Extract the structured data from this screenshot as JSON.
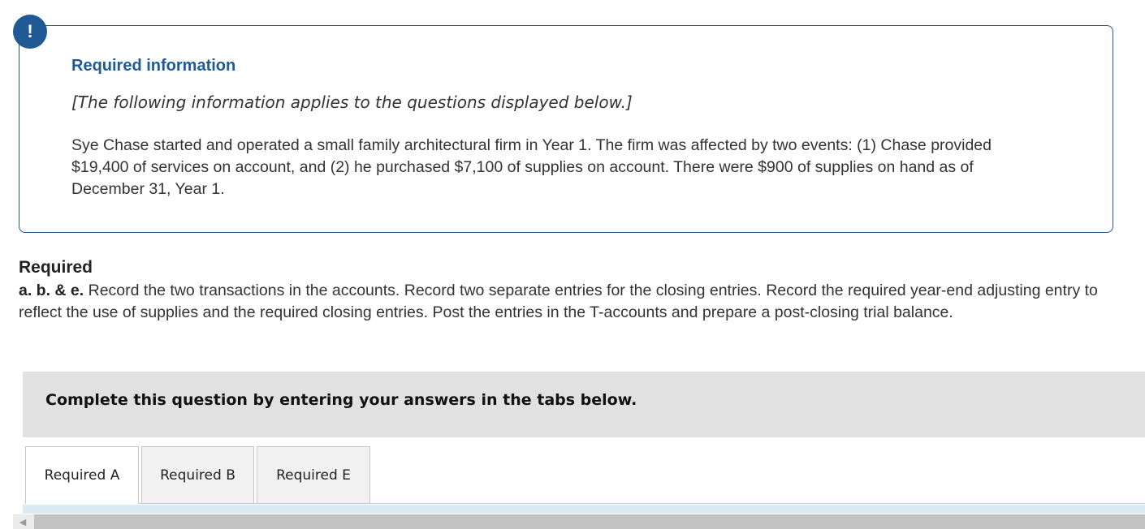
{
  "alert": {
    "icon_glyph": "!",
    "icon": "exclamation-icon",
    "color": "#1f5a96"
  },
  "info": {
    "title": "Required information",
    "italic_note": "[The following information applies to the questions displayed below.]",
    "body": "Sye Chase started and operated a small family architectural firm in Year 1. The firm was affected by two events: (1) Chase provided $19,400 of services on account, and (2) he purchased $7,100 of supplies on account. There were $900 of supplies on hand as of December 31, Year 1."
  },
  "required": {
    "heading": "Required",
    "label": "a. b. & e.",
    "text": "Record the two transactions in the accounts. Record two separate entries for the closing entries. Record the required year-end adjusting entry to reflect the use of supplies and the required closing entries. Post the entries in the T-accounts and prepare a post-closing trial balance."
  },
  "instructions": {
    "text": "Complete this question by entering your answers in the tabs below."
  },
  "tabs": [
    {
      "label": "Required A",
      "active": true
    },
    {
      "label": "Required B",
      "active": false
    },
    {
      "label": "Required E",
      "active": false
    }
  ],
  "scrollbar": {
    "left_arrow_glyph": "◀"
  }
}
